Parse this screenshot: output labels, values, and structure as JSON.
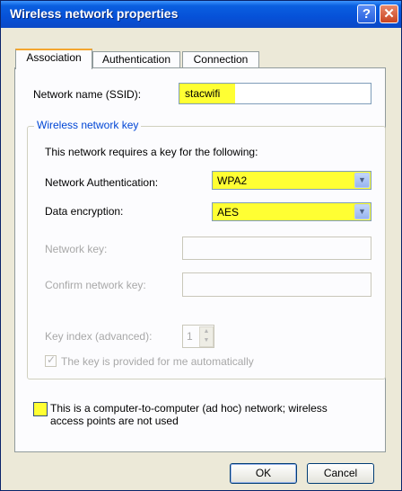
{
  "window": {
    "title": "Wireless network properties"
  },
  "titlebar": {
    "help_glyph": "?",
    "close_glyph": "✕"
  },
  "tabs": [
    {
      "label": "Association",
      "active": true
    },
    {
      "label": "Authentication",
      "active": false
    },
    {
      "label": "Connection",
      "active": false
    }
  ],
  "association": {
    "ssid_label": "Network name (SSID):",
    "ssid_value": "stacwifi",
    "group_label": "Wireless network key",
    "key_required_text": "This network requires a key for the following:",
    "auth_label": "Network Authentication:",
    "auth_value": "WPA2",
    "encryption_label": "Data encryption:",
    "encryption_value": "AES",
    "network_key_label": "Network key:",
    "network_key_value": "",
    "confirm_key_label": "Confirm network key:",
    "confirm_key_value": "",
    "key_index_label": "Key index (advanced):",
    "key_index_value": "1",
    "auto_key_label": "The key is provided for me automatically",
    "auto_key_checked": true,
    "adhoc_label_line1": "This is a computer-to-computer (ad hoc) network; wireless",
    "adhoc_label_line2": "access points are not used",
    "adhoc_checked": false
  },
  "buttons": {
    "ok": "OK",
    "cancel": "Cancel"
  },
  "colors": {
    "highlight": "#ffff33",
    "title_blue": "#0651d8",
    "group_label": "#0046d5"
  }
}
